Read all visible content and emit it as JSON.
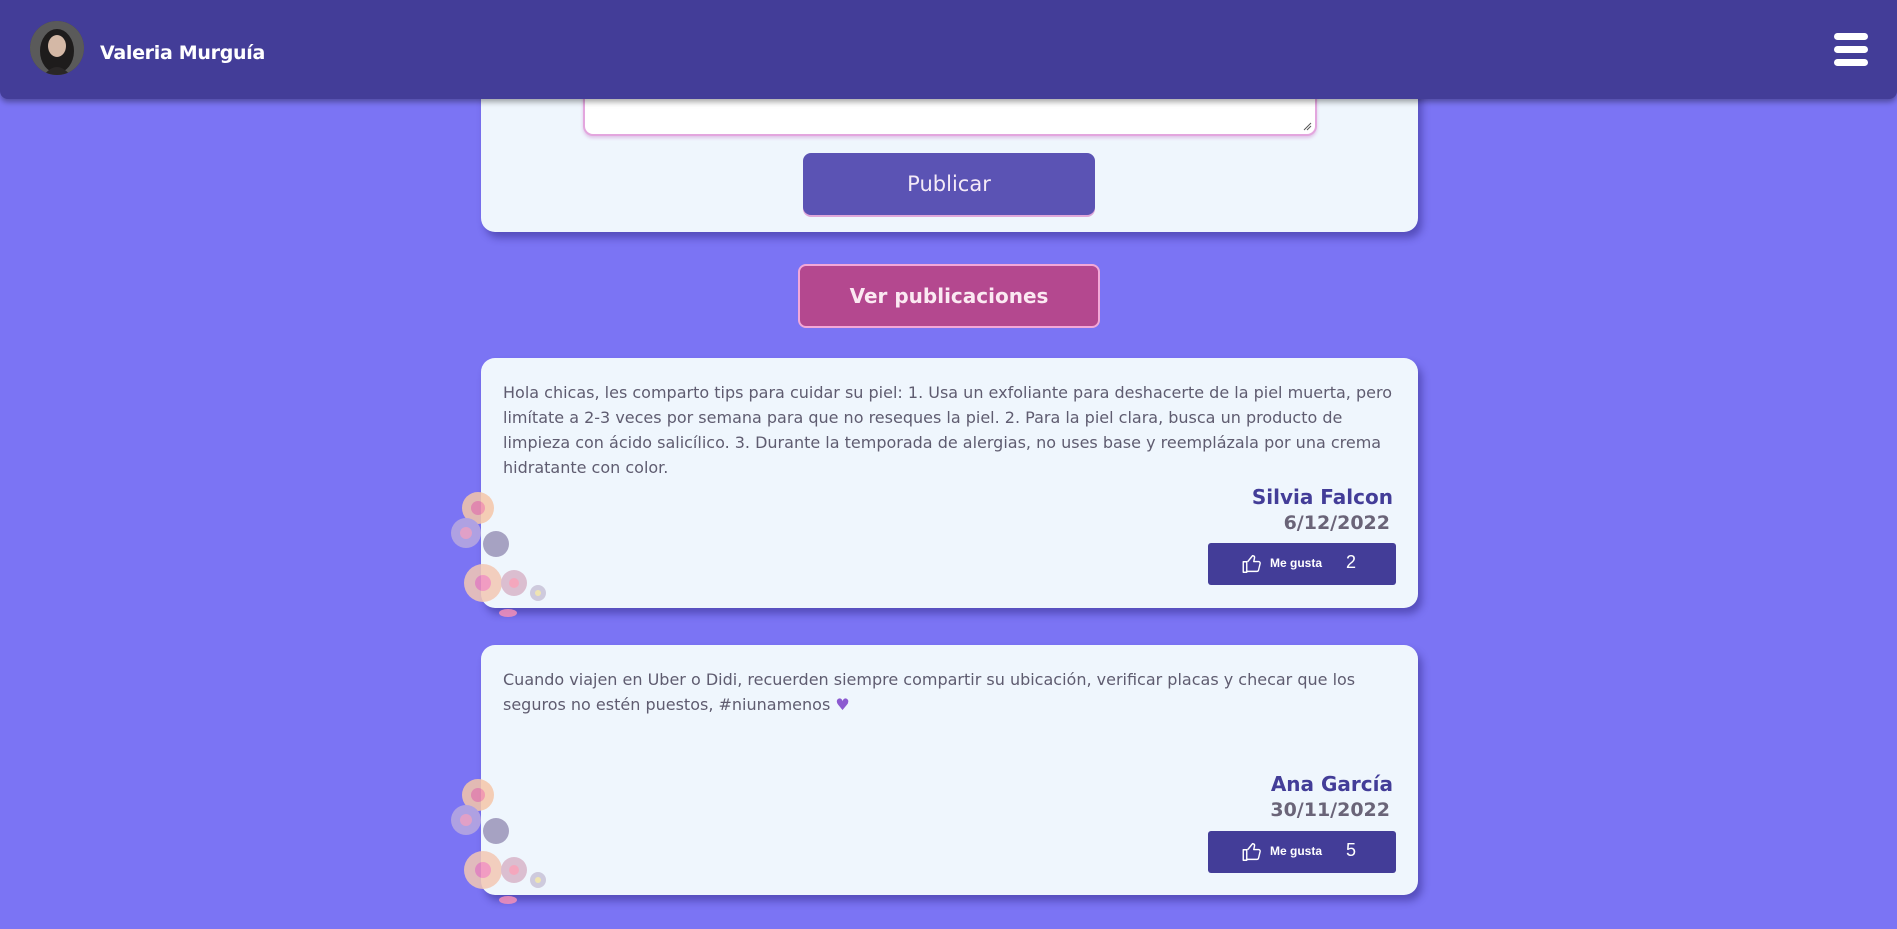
{
  "header": {
    "user_name": "Valeria Murguía"
  },
  "composer": {
    "publish_label": "Publicar"
  },
  "view_posts_label": "Ver publicaciones",
  "posts": [
    {
      "text": "Hola chicas, les comparto tips para cuidar su piel: 1. Usa un exfoliante para deshacerte de la piel muerta, pero limítate a 2-3 veces por semana para que no reseques la piel. 2. Para la piel clara, busca un producto de limpieza con ácido salicílico. 3. Durante la temporada de alergias, no uses base y reemplázala por una crema hidratante con color.",
      "author": "Silvia Falcon",
      "date": "6/12/2022",
      "like_label": "Me gusta",
      "likes": "2"
    },
    {
      "text": "Cuando viajen en Uber o Didi, recuerden siempre compartir su ubicación, verificar placas y checar que los seguros no estén puestos, #niunamenos",
      "author": "Ana García",
      "date": "30/11/2022",
      "like_label": "Me gusta",
      "likes": "5"
    }
  ],
  "icons": {
    "menu": "hamburger-menu-icon",
    "like": "thumbs-up-icon",
    "heart": "purple-heart-emoji"
  },
  "colors": {
    "background": "#7b74f4",
    "header": "#433d98",
    "card": "#eff6fd",
    "publish_button": "#5b53b4",
    "view_button": "#b4488f",
    "author": "#433d98"
  }
}
